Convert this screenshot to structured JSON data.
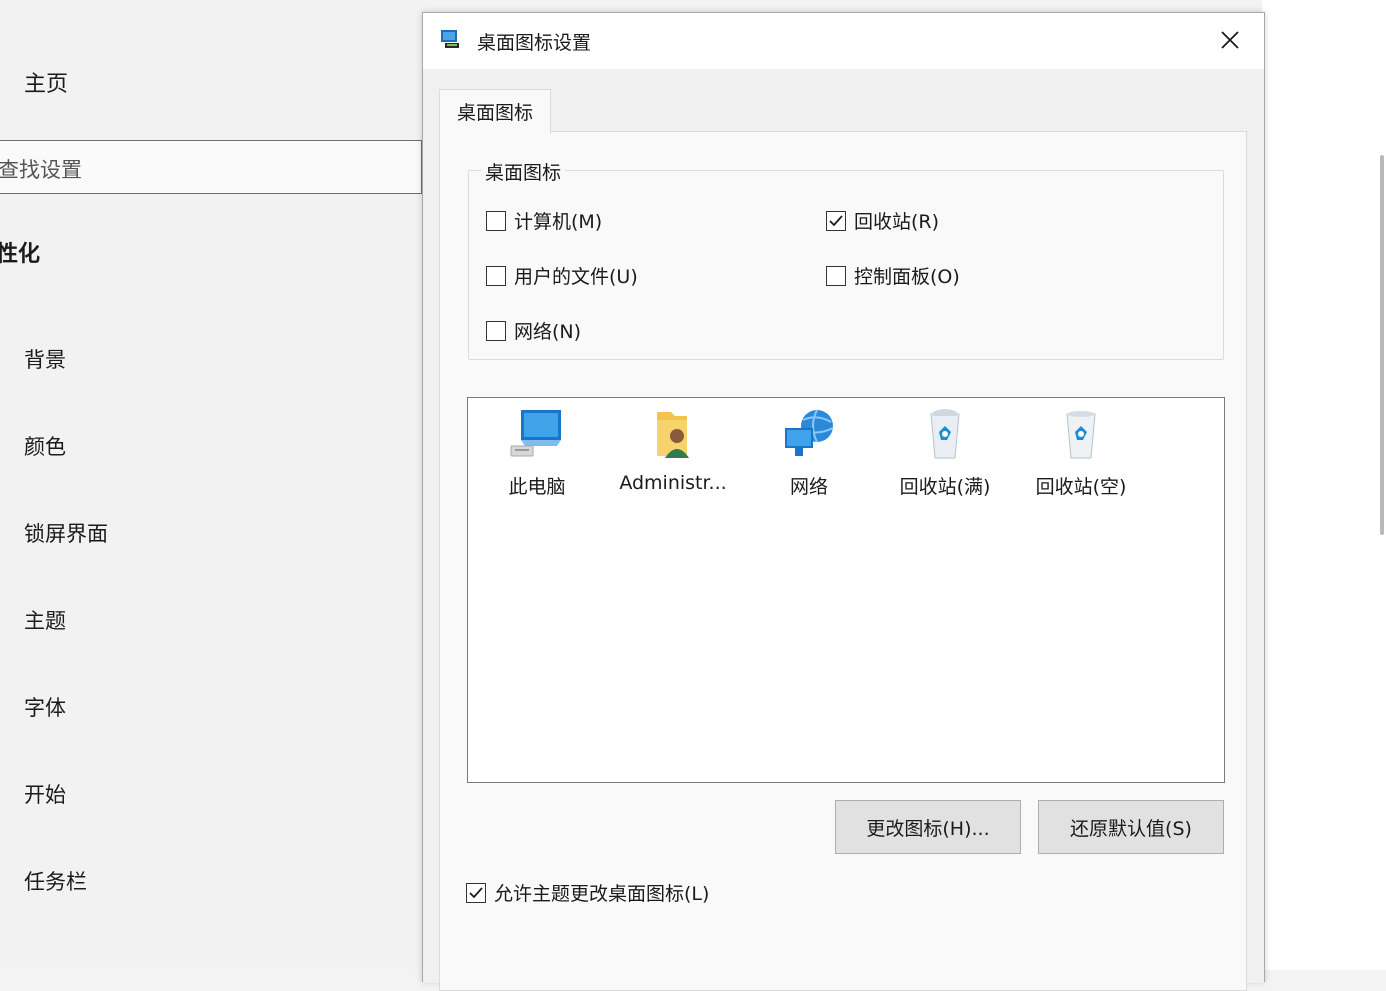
{
  "settings": {
    "home_label": "主页",
    "search_placeholder": "查找设置",
    "section_title": "性化",
    "nav_items": [
      {
        "label": "背景"
      },
      {
        "label": "颜色"
      },
      {
        "label": "锁屏界面"
      },
      {
        "label": "主题"
      },
      {
        "label": "字体"
      },
      {
        "label": "开始"
      },
      {
        "label": "任务栏"
      }
    ]
  },
  "dialog": {
    "title": "桌面图标设置",
    "close_icon": "close-icon",
    "tab_label": "桌面图标",
    "group_legend": "桌面图标",
    "checkboxes": {
      "computer": {
        "label": "计算机(M)",
        "checked": false
      },
      "recycle_bin": {
        "label": "回收站(R)",
        "checked": true
      },
      "user_files": {
        "label": "用户的文件(U)",
        "checked": false
      },
      "control_panel": {
        "label": "控制面板(O)",
        "checked": false
      },
      "network": {
        "label": "网络(N)",
        "checked": false
      }
    },
    "icons": [
      {
        "label": "此电脑",
        "icon": "this-pc-icon"
      },
      {
        "label": "Administr...",
        "icon": "user-folder-icon"
      },
      {
        "label": "网络",
        "icon": "network-icon"
      },
      {
        "label": "回收站(满)",
        "icon": "recycle-bin-full-icon"
      },
      {
        "label": "回收站(空)",
        "icon": "recycle-bin-empty-icon"
      }
    ],
    "change_icon_button": "更改图标(H)...",
    "restore_default_button": "还原默认值(S)",
    "allow_themes": {
      "label": "允许主题更改桌面图标(L)",
      "checked": true
    }
  }
}
